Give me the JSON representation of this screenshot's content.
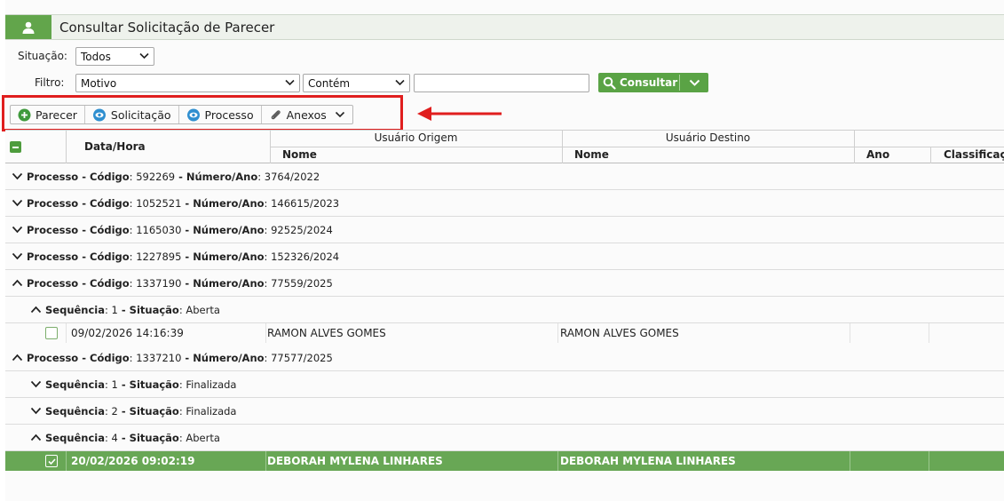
{
  "page": {
    "title": "Consultar Solicitação de Parecer"
  },
  "filters": {
    "situacao_label": "Situação:",
    "situacao_value": "Todos",
    "filtro_label": "Filtro:",
    "filtro_field": "Motivo",
    "filtro_operator": "Contém",
    "filtro_text": "",
    "consultar_label": "Consultar"
  },
  "toolbar": {
    "parecer": "Parecer",
    "solicitacao": "Solicitação",
    "processo": "Processo",
    "anexos": "Anexos"
  },
  "grid": {
    "col_datahora": "Data/Hora",
    "col_usuario_origem": "Usuário Origem",
    "col_usuario_destino": "Usuário Destino",
    "col_nome_origem": "Nome",
    "col_nome_destino": "Nome",
    "col_ano": "Ano",
    "col_classificacao": "Classificaçã"
  },
  "group_labels": {
    "processo": "Processo",
    "codigo": "Código",
    "numero_ano": "Número/Ano",
    "sequencia": "Sequência",
    "situacao": "Situação"
  },
  "processes": [
    {
      "codigo": "592269",
      "numero_ano": "3764/2022"
    },
    {
      "codigo": "1052521",
      "numero_ano": "146615/2023"
    },
    {
      "codigo": "1165030",
      "numero_ano": "92525/2024"
    },
    {
      "codigo": "1227895",
      "numero_ano": "152326/2024"
    },
    {
      "codigo": "1337190",
      "numero_ano": "77559/2025",
      "sequences": [
        {
          "sequencia": "1",
          "situacao": "Aberta"
        }
      ]
    },
    {
      "codigo": "1337210",
      "numero_ano": "77577/2025",
      "sequences": [
        {
          "sequencia": "1",
          "situacao": "Finalizada"
        },
        {
          "sequencia": "2",
          "situacao": "Finalizada"
        },
        {
          "sequencia": "4",
          "situacao": "Aberta"
        }
      ]
    }
  ],
  "rows": [
    {
      "datahora": "09/02/2026 14:16:39",
      "origem": "RAMON ALVES GOMES",
      "destino": "RAMON ALVES GOMES",
      "selected": false
    },
    {
      "datahora": "20/02/2026 09:02:19",
      "origem": "DEBORAH MYLENA LINHARES",
      "destino": "DEBORAH MYLENA LINHARES",
      "selected": true
    }
  ],
  "colors": {
    "accent": "#62a54b",
    "selected_row": "#68a755",
    "highlight": "#e01e1e",
    "info_blue": "#2f8fd0"
  },
  "icons": {
    "title": "user-icon",
    "consultar": "search-icon",
    "parecer": "plus-circle-icon",
    "solicitacao": "eye-icon",
    "processo": "eye-icon",
    "anexos": "paperclip-icon"
  }
}
